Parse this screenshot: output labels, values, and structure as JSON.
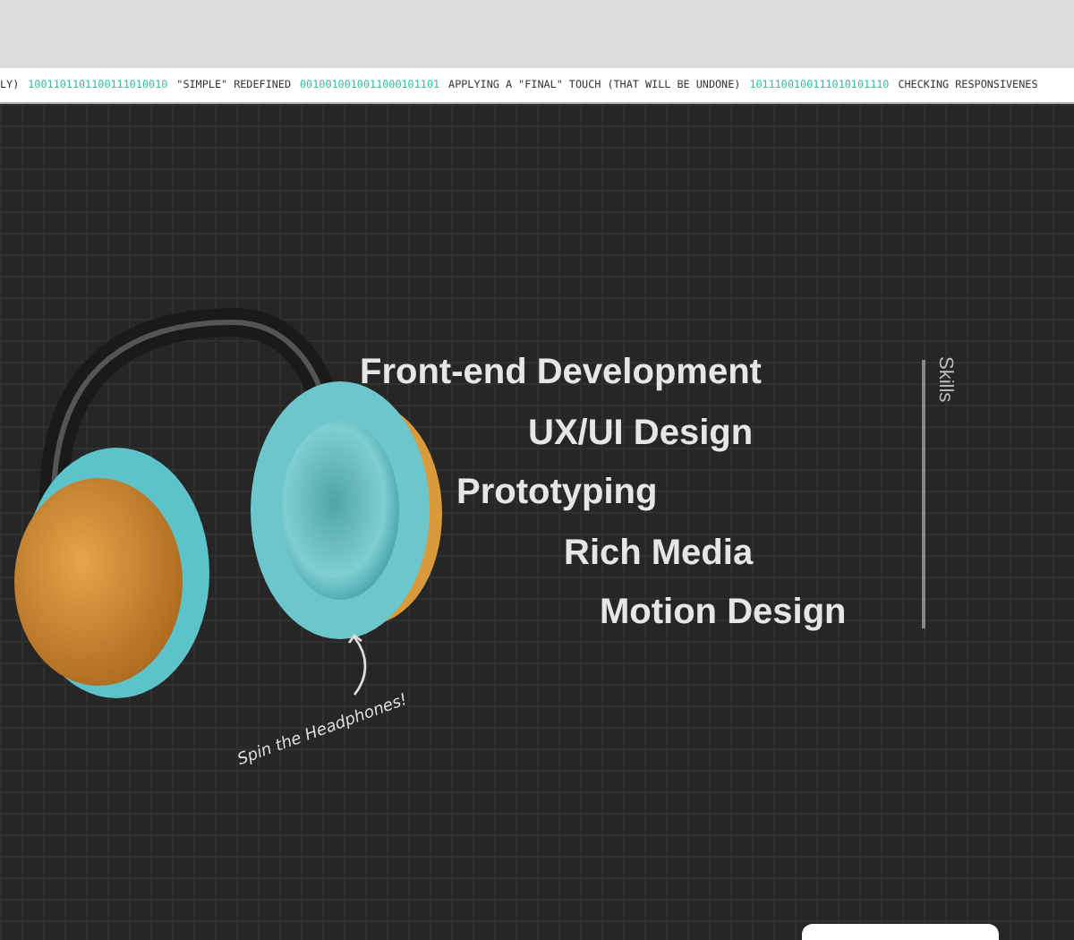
{
  "ticker": [
    {
      "kind": "text",
      "text": "LY)"
    },
    {
      "kind": "binary",
      "text": "1001101101100111010010"
    },
    {
      "kind": "text",
      "text": "\"SIMPLE\" REDEFINED"
    },
    {
      "kind": "binary",
      "text": "0010010010011000101101"
    },
    {
      "kind": "text",
      "text": "APPLYING A \"FINAL\" TOUCH (THAT WILL BE UNDONE)"
    },
    {
      "kind": "binary",
      "text": "1011100100111010101110"
    },
    {
      "kind": "text",
      "text": "CHECKING RESPONSIVENES"
    }
  ],
  "skills": {
    "heading": "Skills",
    "items": [
      "Front-end Development",
      "UX/UI Design",
      "Prototyping",
      "Rich Media",
      "Motion Design"
    ]
  },
  "hint": "Spin the Headphones!"
}
